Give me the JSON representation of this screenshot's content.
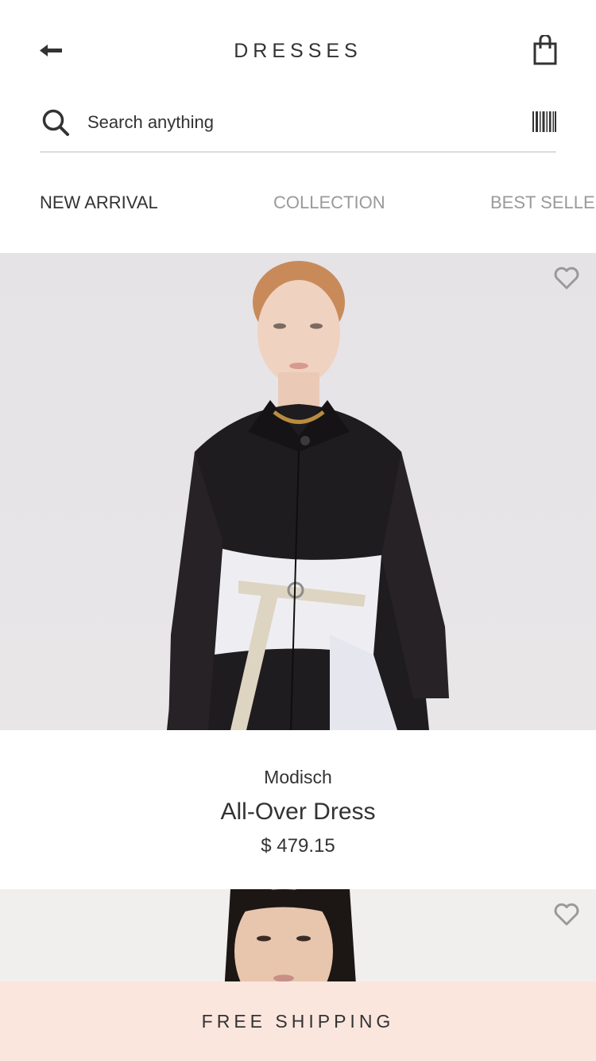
{
  "header": {
    "back_icon": "arrow-left-icon",
    "title": "DRESSES",
    "bag_icon": "shopping-bag-icon"
  },
  "search": {
    "icon": "search-icon",
    "placeholder": "Search anything",
    "scan_icon": "barcode-icon"
  },
  "tabs": [
    {
      "label": "NEW ARRIVAL",
      "active": true
    },
    {
      "label": "COLLECTION",
      "active": false
    },
    {
      "label": "BEST SELLER",
      "active": false
    }
  ],
  "products": [
    {
      "brand": "Modisch",
      "name": "All-Over Dress",
      "price": "$ 479.15",
      "favorite_icon": "heart-outline-icon"
    },
    {
      "favorite_icon": "heart-outline-icon"
    }
  ],
  "banner": {
    "text": "FREE SHIPPING",
    "background": "#fbe6de"
  }
}
